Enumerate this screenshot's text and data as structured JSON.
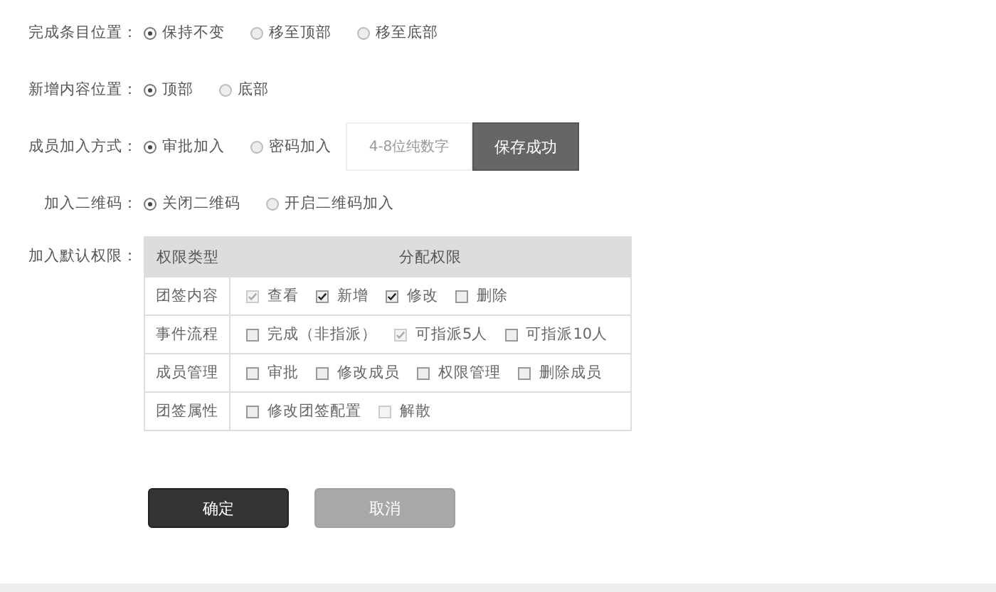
{
  "settings": [
    {
      "label": "完成条目位置：",
      "options": [
        {
          "label": "保持不变",
          "selected": true
        },
        {
          "label": "移至顶部",
          "selected": false
        },
        {
          "label": "移至底部",
          "selected": false
        }
      ]
    },
    {
      "label": "新增内容位置：",
      "options": [
        {
          "label": "顶部",
          "selected": true
        },
        {
          "label": "底部",
          "selected": false
        }
      ]
    },
    {
      "label": "成员加入方式：",
      "options": [
        {
          "label": "审批加入",
          "selected": true
        },
        {
          "label": "密码加入",
          "selected": false
        }
      ],
      "password": {
        "placeholder": "4-8位纯数字"
      },
      "save_button": "保存成功"
    },
    {
      "label": "加入二维码：",
      "options": [
        {
          "label": "关闭二维码",
          "selected": true
        },
        {
          "label": "开启二维码加入",
          "selected": false
        }
      ]
    }
  ],
  "permissions": {
    "label": "加入默认权限：",
    "columns": [
      "权限类型",
      "分配权限"
    ],
    "rows": [
      {
        "type": "团签内容",
        "items": [
          {
            "label": "查看",
            "checked": true,
            "disabled": true
          },
          {
            "label": "新增",
            "checked": true,
            "disabled": false
          },
          {
            "label": "修改",
            "checked": true,
            "disabled": false
          },
          {
            "label": "删除",
            "checked": false,
            "disabled": false
          }
        ]
      },
      {
        "type": "事件流程",
        "items": [
          {
            "label": "完成（非指派）",
            "checked": false,
            "disabled": false
          },
          {
            "label": "可指派5人",
            "checked": true,
            "disabled": true
          },
          {
            "label": "可指派10人",
            "checked": false,
            "disabled": false
          }
        ]
      },
      {
        "type": "成员管理",
        "items": [
          {
            "label": "审批",
            "checked": false,
            "disabled": false
          },
          {
            "label": "修改成员",
            "checked": false,
            "disabled": false
          },
          {
            "label": "权限管理",
            "checked": false,
            "disabled": false
          },
          {
            "label": "删除成员",
            "checked": false,
            "disabled": false
          }
        ]
      },
      {
        "type": "团签属性",
        "items": [
          {
            "label": "修改团签配置",
            "checked": false,
            "disabled": false
          },
          {
            "label": "解散",
            "checked": false,
            "disabled": true
          }
        ]
      }
    ]
  },
  "buttons": {
    "confirm": "确定",
    "cancel": "取消"
  }
}
